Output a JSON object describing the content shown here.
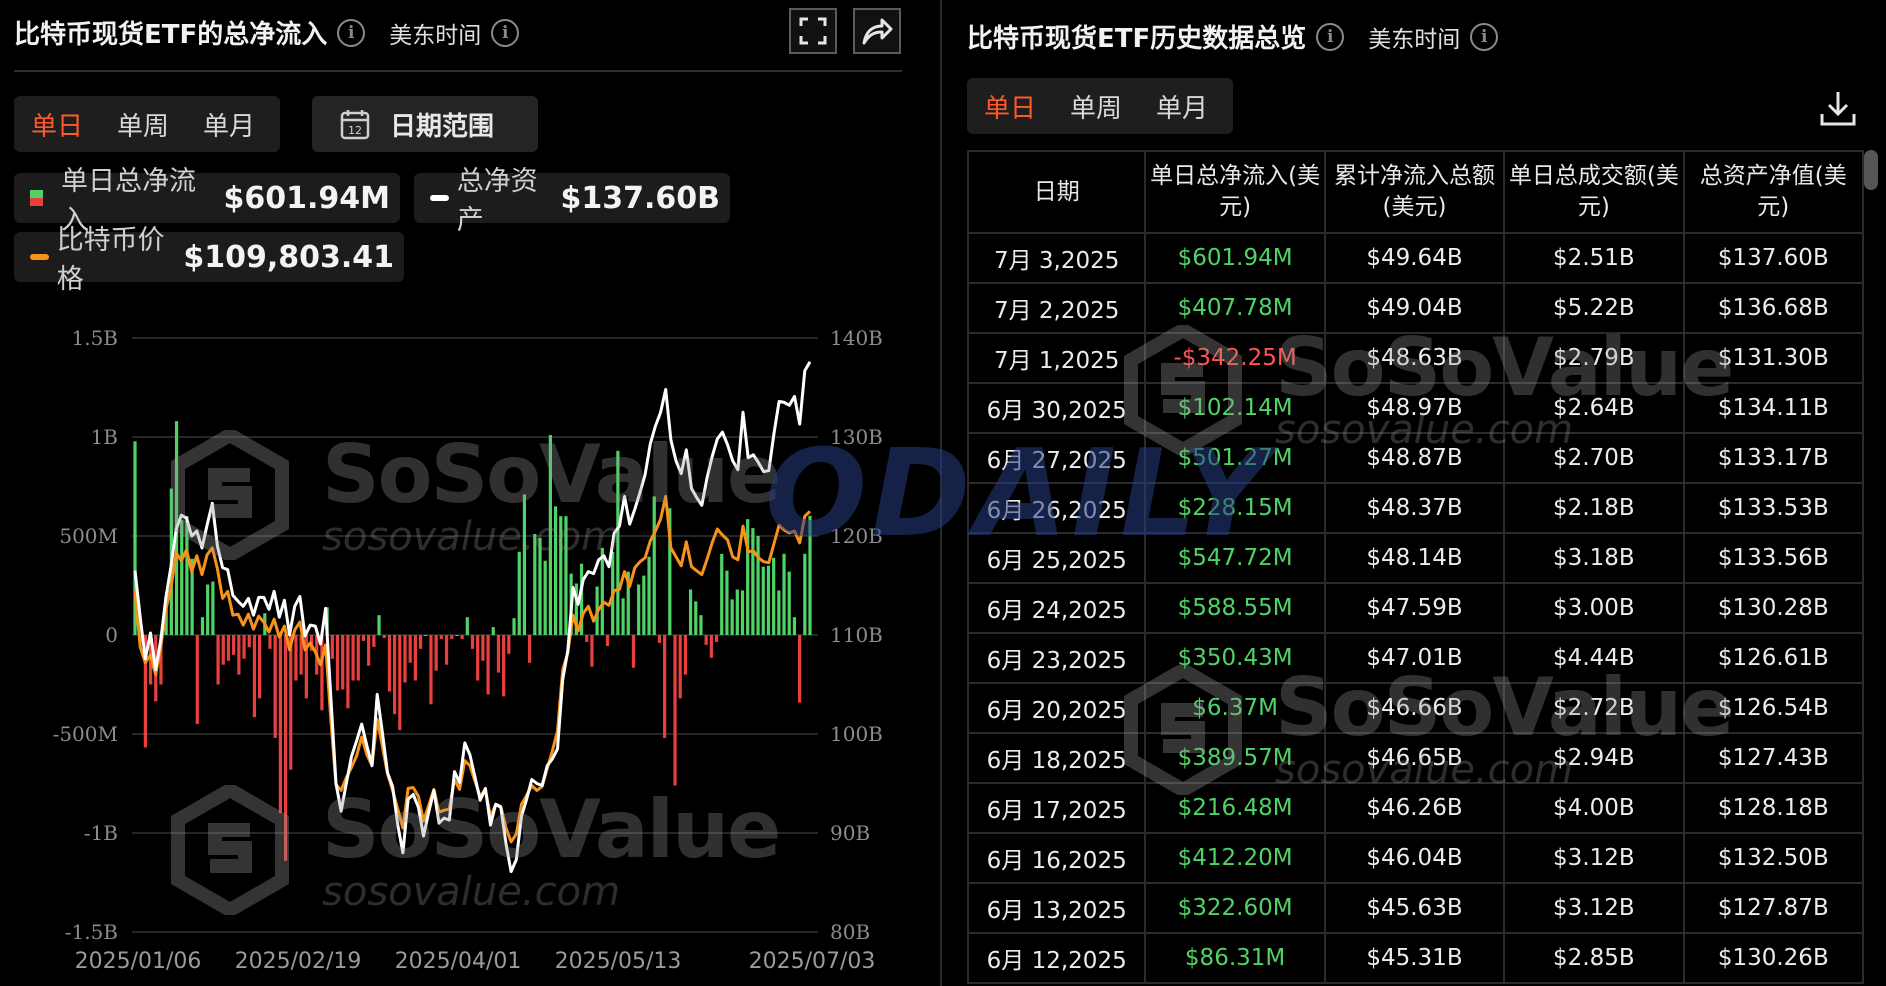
{
  "left": {
    "title": "比特币现货ETF的总净流入",
    "timezone": "美东时间",
    "tabs": [
      "单日",
      "单周",
      "单月"
    ],
    "active_tab": "单日",
    "date_range_label": "日期范围",
    "legend": {
      "flow_label": "单日总净流入",
      "flow_value": "$601.94M",
      "assets_label": "总净资产",
      "assets_value": "$137.60B",
      "price_label": "比特币价格",
      "price_value": "$109,803.41"
    },
    "watermark": {
      "brand": "SoSoValue",
      "site": "sosovalue.com"
    }
  },
  "chart_data": {
    "type": "bar",
    "left_axis_ticks": [
      "1.5B",
      "1B",
      "500M",
      "0",
      "-500M",
      "-1B",
      "-1.5B"
    ],
    "right_axis_ticks": [
      "140B",
      "130B",
      "120B",
      "110B",
      "100B",
      "90B",
      "80B"
    ],
    "x_ticks": [
      "2025/01/06",
      "2025/02/19",
      "2025/04/01",
      "2025/05/13",
      "2025/07/03"
    ],
    "ylim_left": [
      -1500,
      1500
    ],
    "ylim_right": [
      80,
      140
    ],
    "colors": {
      "inflow": "#4fd266",
      "outflow": "#e8403d",
      "assets": "#ffffff",
      "price": "#f7931a"
    },
    "daily_net_inflow_musd": [
      978,
      -60,
      -568,
      -250,
      -335,
      -250,
      185,
      740,
      1080,
      580,
      600,
      385,
      -450,
      90,
      255,
      270,
      -250,
      -150,
      -130,
      -100,
      -200,
      -120,
      -62,
      -415,
      -320,
      110,
      -70,
      -520,
      -900,
      -1140,
      -680,
      -230,
      -200,
      -320,
      -80,
      -200,
      -380,
      140,
      -120,
      -280,
      -275,
      -370,
      -230,
      -230,
      -30,
      -155,
      -60,
      100,
      -15,
      -285,
      -400,
      -480,
      -240,
      -140,
      -230,
      -70,
      0,
      -350,
      -180,
      -20,
      -150,
      -20,
      0,
      -20,
      90,
      -70,
      -230,
      -130,
      -300,
      40,
      -190,
      -310,
      -95,
      85,
      420,
      710,
      -140,
      510,
      490,
      375,
      1010,
      650,
      600,
      600,
      310,
      260,
      360,
      -35,
      -160,
      245,
      440,
      -55,
      420,
      930,
      185,
      320,
      -165,
      255,
      300,
      395,
      700,
      -40,
      -520,
      640,
      -760,
      -320,
      -200,
      230,
      170,
      100,
      -50,
      -115,
      -35,
      410,
      325,
      180,
      230,
      225,
      585,
      540,
      500,
      345,
      350,
      390,
      225,
      410,
      320,
      90,
      -342,
      410,
      602
    ],
    "total_net_assets_busd": [
      116.5,
      111.8,
      107.6,
      110.2,
      106.5,
      109.5,
      113.8,
      117.0,
      120.7,
      122.1,
      121.8,
      120.0,
      120.5,
      118.8,
      121.1,
      123.3,
      119.0,
      116.8,
      116.6,
      114.0,
      113.4,
      112.9,
      113.7,
      112.0,
      113.8,
      113.8,
      112.6,
      114.4,
      111.8,
      113.5,
      110.0,
      112.9,
      113.9,
      109.9,
      111.0,
      110.9,
      109.1,
      112.7,
      103.8,
      95.0,
      92.2,
      95.0,
      97.7,
      99.3,
      101.0,
      98.8,
      96.8,
      104.0,
      100.2,
      96.1,
      94.7,
      90.8,
      88.0,
      93.4,
      93.9,
      92.6,
      89.7,
      92.1,
      94.3,
      91.0,
      91.5,
      91.3,
      96.2,
      95.1,
      99.1,
      97.9,
      95.6,
      93.3,
      94.5,
      90.8,
      92.9,
      92.6,
      88.9,
      86.1,
      87.3,
      91.7,
      93.4,
      95.4,
      95.0,
      94.8,
      96.8,
      97.5,
      98.5,
      105.5,
      108.4,
      114.8,
      113.1,
      115.6,
      116.4,
      116.2,
      117.6,
      118.0,
      116.9,
      120.3,
      121.0,
      124.0,
      121.2,
      122.7,
      124.4,
      126.2,
      129.3,
      131.1,
      132.5,
      134.8,
      129.7,
      127.6,
      126.3,
      128.7,
      124.8,
      123.9,
      123.1,
      125.8,
      128.0,
      129.8,
      130.5,
      129.2,
      127.6,
      126.7,
      132.5,
      127.9,
      128.2,
      127.4,
      126.5,
      126.6,
      130.3,
      133.6,
      133.5,
      133.2,
      134.1,
      131.3,
      136.7,
      137.6
    ],
    "btc_price_musd_scaled": [
      114.5,
      108.8,
      107.2,
      108.0,
      106.0,
      108.8,
      112.6,
      114.9,
      118.3,
      117.5,
      118.6,
      116.4,
      118.0,
      116.1,
      118.1,
      118.8,
      116.7,
      113.7,
      114.4,
      112.0,
      112.1,
      111.0,
      112.1,
      110.6,
      111.9,
      111.3,
      110.3,
      111.6,
      109.8,
      110.9,
      108.5,
      110.5,
      111.3,
      108.5,
      109.2,
      108.3,
      107.0,
      109.0,
      101.5,
      94.9,
      94.3,
      95.6,
      96.6,
      97.8,
      99.7,
      97.9,
      96.8,
      101.5,
      98.8,
      96.0,
      94.3,
      92.4,
      90.5,
      94.5,
      94.6,
      93.7,
      91.2,
      92.8,
      94.4,
      92.1,
      92.3,
      92.4,
      95.4,
      94.4,
      97.3,
      96.8,
      95.2,
      93.7,
      94.4,
      91.6,
      92.9,
      92.7,
      90.5,
      89.1,
      89.9,
      92.9,
      93.8,
      94.8,
      94.3,
      94.7,
      96.5,
      98.3,
      100.3,
      106.5,
      108.2,
      112.0,
      110.4,
      112.2,
      112.9,
      111.4,
      112.6,
      113.3,
      113.0,
      114.5,
      114.6,
      116.4,
      114.9,
      116.8,
      117.4,
      117.8,
      119.5,
      120.5,
      121.7,
      124.0,
      118.8,
      117.9,
      117.0,
      119.4,
      116.9,
      116.5,
      116.1,
      117.6,
      119.3,
      120.7,
      120.1,
      119.6,
      117.9,
      117.6,
      121.0,
      118.4,
      118.5,
      117.8,
      117.4,
      117.3,
      119.2,
      121.1,
      120.6,
      120.3,
      120.5,
      119.3,
      122.0,
      122.5
    ]
  },
  "right": {
    "title": "比特币现货ETF历史数据总览",
    "timezone": "美东时间",
    "tabs": [
      "单日",
      "单周",
      "单月"
    ],
    "active_tab": "单日",
    "headers": [
      "日期",
      "单日总净流入(美元)",
      "累计净流入总额(美元)",
      "单日总成交额(美元)",
      "总资产净值(美元)"
    ],
    "rows": [
      {
        "date": "7月 3,2025",
        "flow": "$601.94M",
        "sign": "pos",
        "cum": "$49.64B",
        "vol": "$2.51B",
        "nav": "$137.60B"
      },
      {
        "date": "7月 2,2025",
        "flow": "$407.78M",
        "sign": "pos",
        "cum": "$49.04B",
        "vol": "$5.22B",
        "nav": "$136.68B"
      },
      {
        "date": "7月 1,2025",
        "flow": "-$342.25M",
        "sign": "neg",
        "cum": "$48.63B",
        "vol": "$2.79B",
        "nav": "$131.30B"
      },
      {
        "date": "6月 30,2025",
        "flow": "$102.14M",
        "sign": "pos",
        "cum": "$48.97B",
        "vol": "$2.64B",
        "nav": "$134.11B"
      },
      {
        "date": "6月 27,2025",
        "flow": "$501.27M",
        "sign": "pos",
        "cum": "$48.87B",
        "vol": "$2.70B",
        "nav": "$133.17B"
      },
      {
        "date": "6月 26,2025",
        "flow": "$228.15M",
        "sign": "pos",
        "cum": "$48.37B",
        "vol": "$2.18B",
        "nav": "$133.53B"
      },
      {
        "date": "6月 25,2025",
        "flow": "$547.72M",
        "sign": "pos",
        "cum": "$48.14B",
        "vol": "$3.18B",
        "nav": "$133.56B"
      },
      {
        "date": "6月 24,2025",
        "flow": "$588.55M",
        "sign": "pos",
        "cum": "$47.59B",
        "vol": "$3.00B",
        "nav": "$130.28B"
      },
      {
        "date": "6月 23,2025",
        "flow": "$350.43M",
        "sign": "pos",
        "cum": "$47.01B",
        "vol": "$4.44B",
        "nav": "$126.61B"
      },
      {
        "date": "6月 20,2025",
        "flow": "$6.37M",
        "sign": "pos",
        "cum": "$46.66B",
        "vol": "$2.72B",
        "nav": "$126.54B"
      },
      {
        "date": "6月 18,2025",
        "flow": "$389.57M",
        "sign": "pos",
        "cum": "$46.65B",
        "vol": "$2.94B",
        "nav": "$127.43B"
      },
      {
        "date": "6月 17,2025",
        "flow": "$216.48M",
        "sign": "pos",
        "cum": "$46.26B",
        "vol": "$4.00B",
        "nav": "$128.18B"
      },
      {
        "date": "6月 16,2025",
        "flow": "$412.20M",
        "sign": "pos",
        "cum": "$46.04B",
        "vol": "$3.12B",
        "nav": "$132.50B"
      },
      {
        "date": "6月 13,2025",
        "flow": "$322.60M",
        "sign": "pos",
        "cum": "$45.63B",
        "vol": "$3.12B",
        "nav": "$127.87B"
      },
      {
        "date": "6月 12,2025",
        "flow": "$86.31M",
        "sign": "pos",
        "cum": "$45.31B",
        "vol": "$2.85B",
        "nav": "$130.26B"
      }
    ],
    "watermark": {
      "brand": "SoSoValue",
      "site": "sosovalue.com"
    },
    "overlay_brand": "ODAILY"
  }
}
